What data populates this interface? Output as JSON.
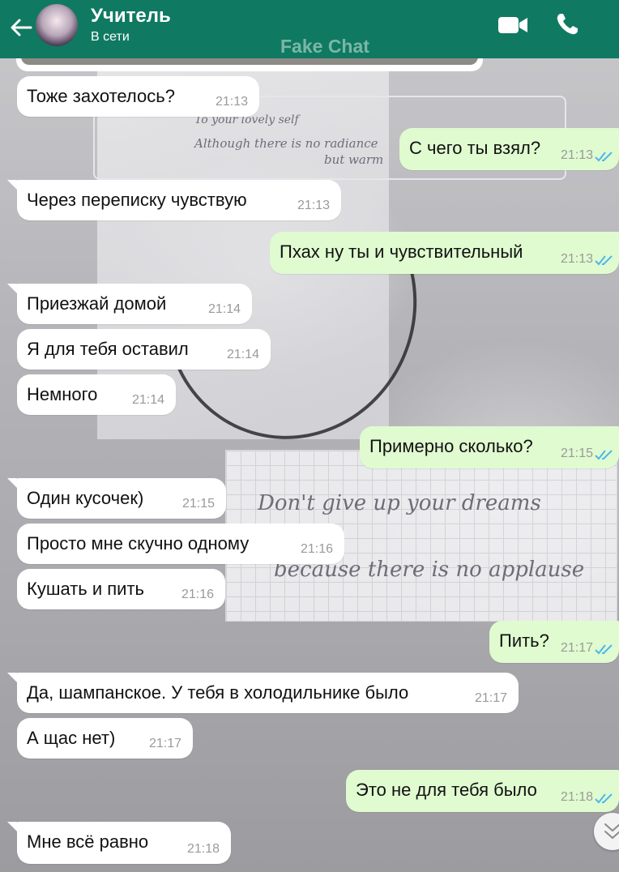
{
  "header": {
    "contact_name": "Учитель",
    "status": "В сети",
    "watermark": "Fake Chat",
    "back_icon": "arrow-left-icon",
    "video_icon": "video-camera-icon",
    "call_icon": "phone-icon",
    "bg_color": "#0f7a61"
  },
  "wallpaper": {
    "line1": "Don't give up your dreams",
    "line2": "because there is no applause",
    "line3": "To your lovely self",
    "line4": "Although there is no radiance",
    "line5": "but warm"
  },
  "messages": [
    {
      "dir": "in",
      "text": "Тоже захотелось?",
      "time": "21:13"
    },
    {
      "dir": "out",
      "text": "С чего ты взял?",
      "time": "21:13",
      "read": true
    },
    {
      "dir": "in",
      "text": "Через переписку чувствую",
      "time": "21:13"
    },
    {
      "dir": "out",
      "text": "Пхах ну ты и чувствительный",
      "time": "21:13",
      "read": true
    },
    {
      "dir": "in",
      "text": "Приезжай домой",
      "time": "21:14"
    },
    {
      "dir": "in",
      "text": "Я для тебя оставил",
      "time": "21:14"
    },
    {
      "dir": "in",
      "text": "Немного",
      "time": "21:14"
    },
    {
      "dir": "out",
      "text": "Примерно сколько?",
      "time": "21:15",
      "read": true
    },
    {
      "dir": "in",
      "text": "Один кусочек)",
      "time": "21:15"
    },
    {
      "dir": "in",
      "text": "Просто мне скучно одному",
      "time": "21:16"
    },
    {
      "dir": "in",
      "text": "Кушать и пить",
      "time": "21:16"
    },
    {
      "dir": "out",
      "text": "Пить?",
      "time": "21:17",
      "read": true
    },
    {
      "dir": "in",
      "text": "Да, шампанское. У тебя в холодильнике было",
      "time": "21:17"
    },
    {
      "dir": "in",
      "text": "А щас нет)",
      "time": "21:17"
    },
    {
      "dir": "out",
      "text": "Это не для тебя было",
      "time": "21:18",
      "read": true
    },
    {
      "dir": "in",
      "text": "Мне всё равно",
      "time": "21:18"
    }
  ],
  "colors": {
    "incoming_bubble": "#ffffff",
    "outgoing_bubble": "#e0fbd0",
    "read_ticks": "#4fb6ec"
  },
  "scroll_icon": "chevrons-down-icon"
}
